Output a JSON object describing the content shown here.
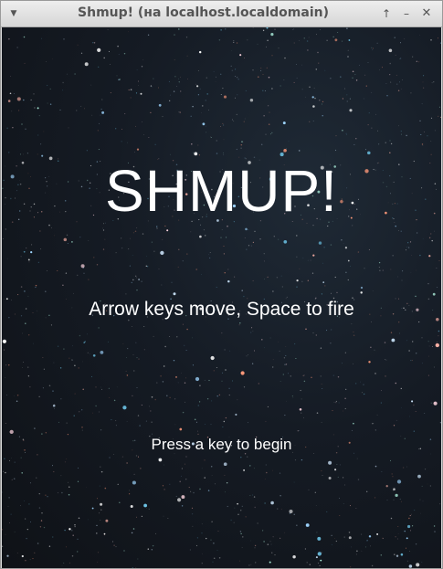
{
  "window": {
    "title": "Shmup! (на localhost.localdomain)",
    "menu_icon": "chevron-down-icon",
    "maximize_icon": "arrow-up-icon",
    "minimize_icon": "minus-icon",
    "close_icon": "close-icon"
  },
  "game": {
    "title": "SHMUP!",
    "instructions": "Arrow keys move, Space to fire",
    "start_prompt": "Press a key to begin",
    "background": "starfield",
    "text_color": "#ffffff"
  }
}
